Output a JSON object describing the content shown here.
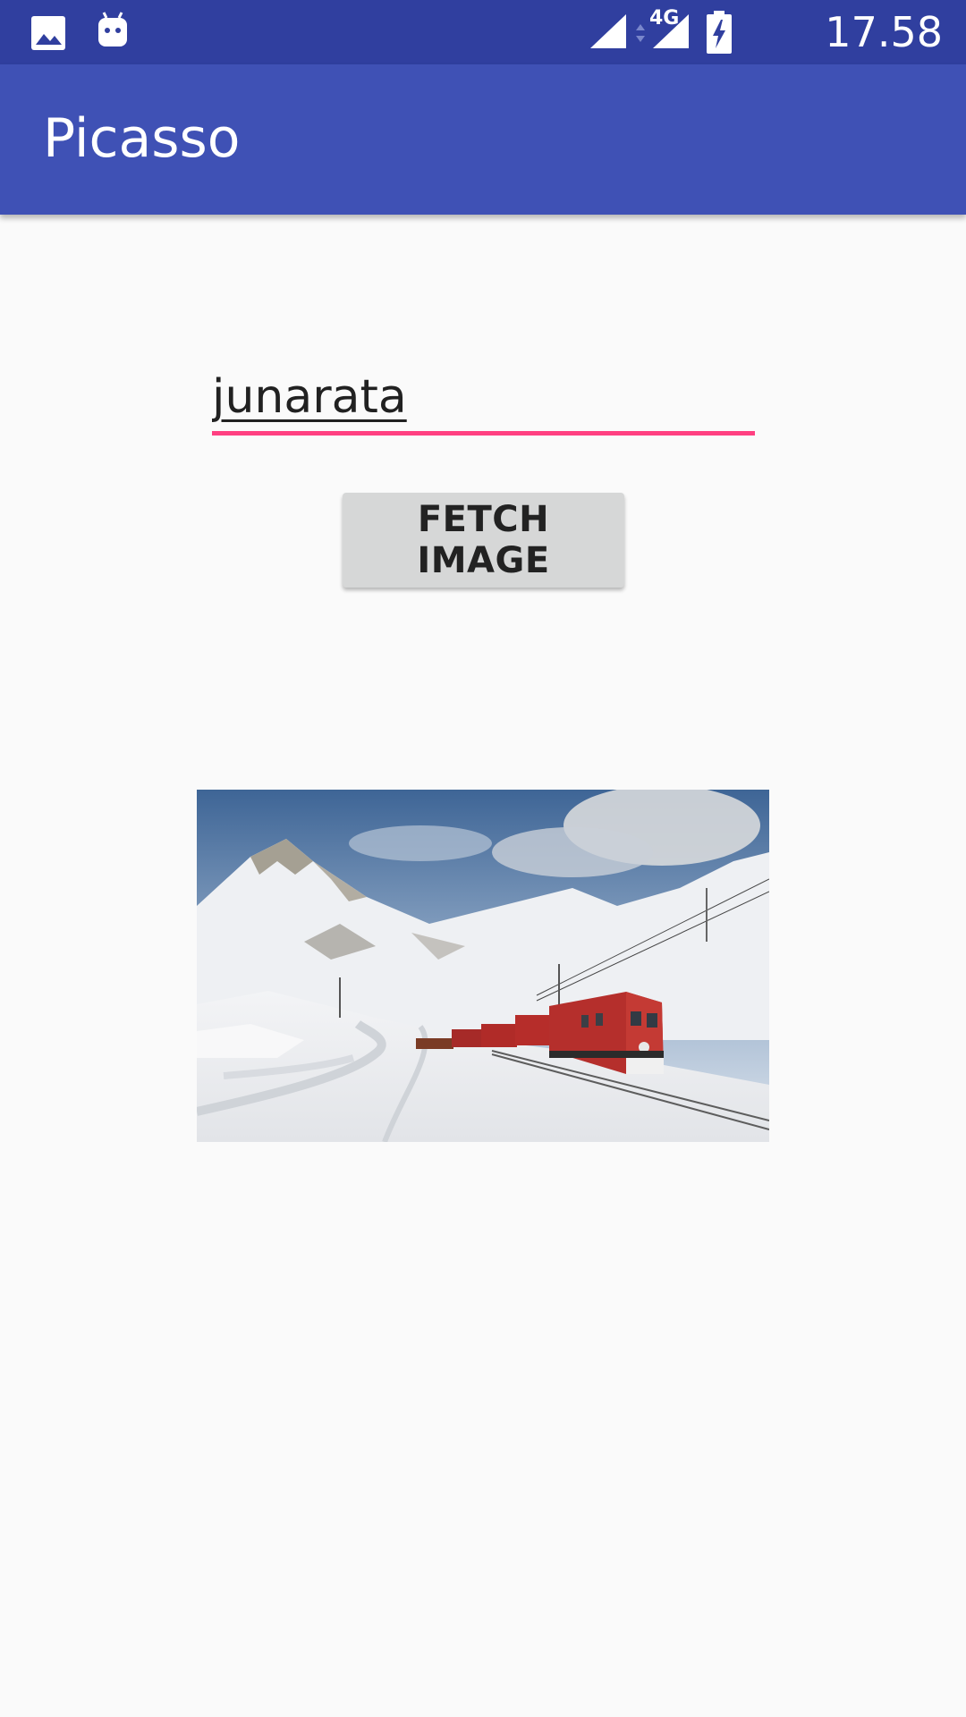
{
  "status_bar": {
    "time": "17.58",
    "network": "4G",
    "icons": [
      "image-icon",
      "android-debug-icon",
      "signal-icon",
      "data-arrows-icon",
      "signal-4g-icon",
      "battery-charging-icon"
    ],
    "background": "#303f9f"
  },
  "app_bar": {
    "title": "Picasso",
    "background": "#3f51b5"
  },
  "form": {
    "input_value": "junarata",
    "underline_color": "#ff4081",
    "fetch_button_label": "FETCH IMAGE"
  },
  "image": {
    "subject": "red train in snowy mountains"
  }
}
